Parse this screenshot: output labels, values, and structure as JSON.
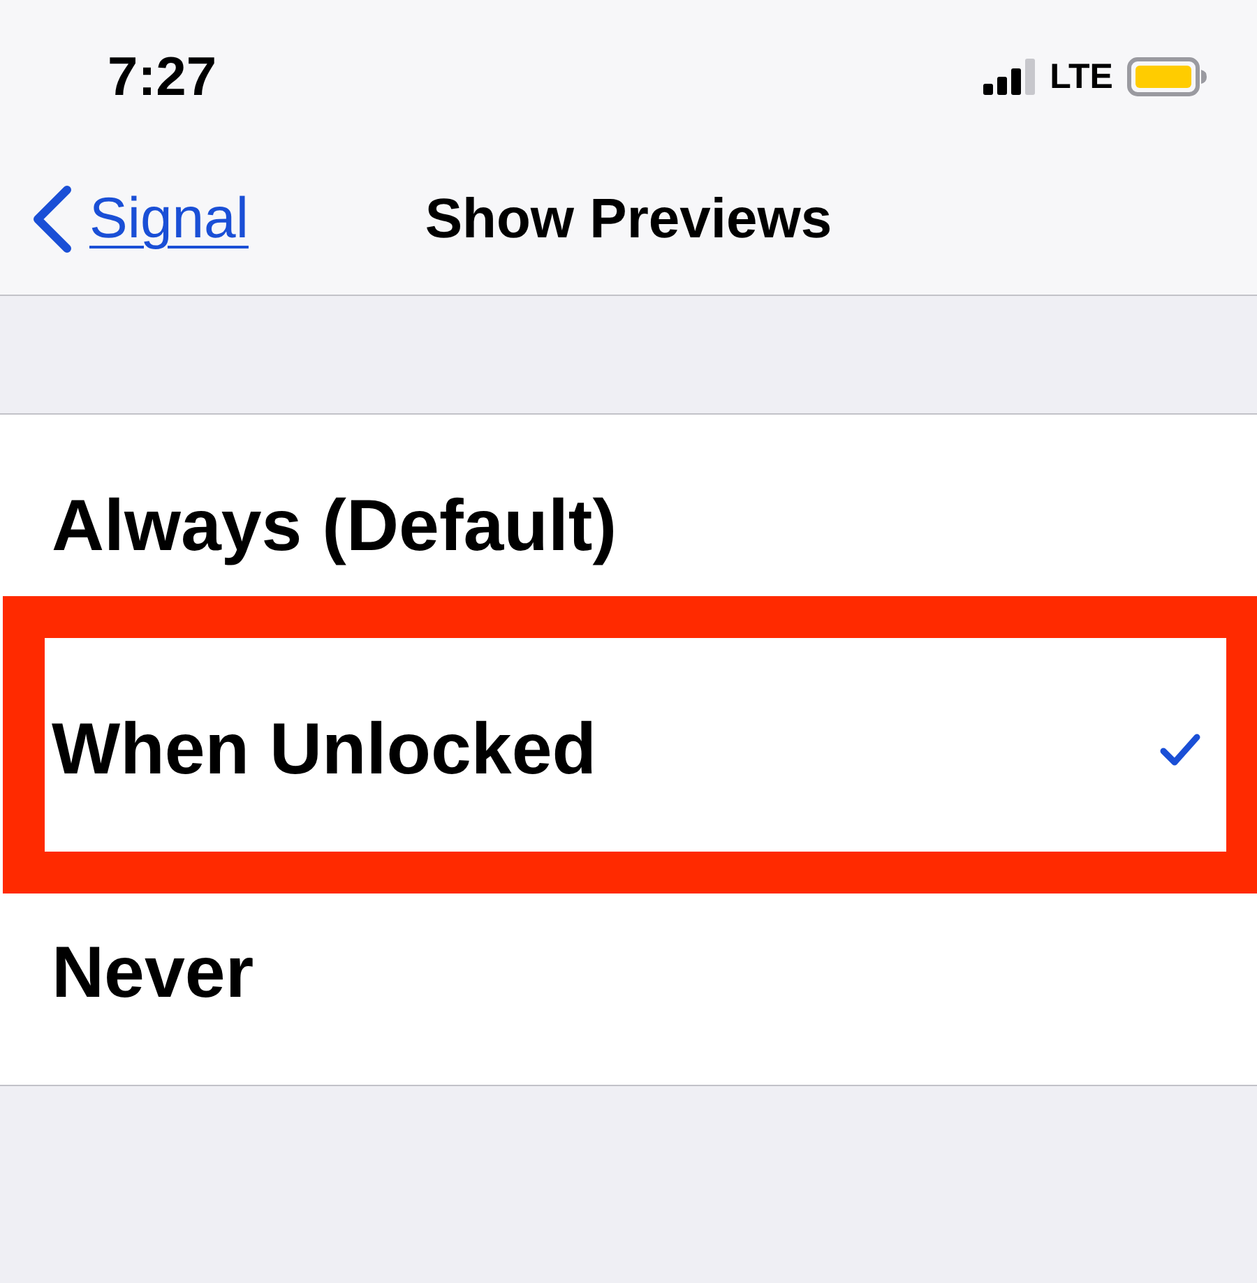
{
  "status_bar": {
    "time": "7:27",
    "network": "LTE"
  },
  "nav_bar": {
    "back_label": "Signal",
    "title": "Show Previews"
  },
  "options": [
    {
      "label": "Always (Default)",
      "selected": false,
      "highlighted": false
    },
    {
      "label": "When Unlocked",
      "selected": true,
      "highlighted": true
    },
    {
      "label": "Never",
      "selected": false,
      "highlighted": false
    }
  ]
}
